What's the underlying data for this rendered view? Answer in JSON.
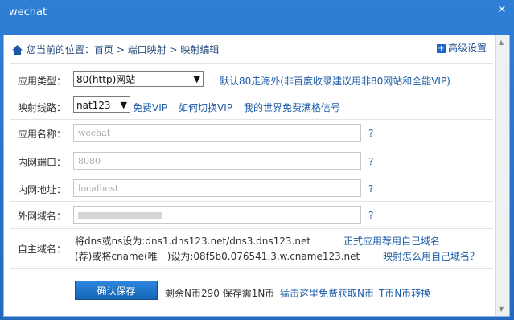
{
  "window": {
    "title": "wechat",
    "minimize": "—",
    "close": "✕"
  },
  "breadcrumb": {
    "text": "您当前的位置：首页 > 端口映射 > 映射编辑"
  },
  "advanced": {
    "label": "高级设置"
  },
  "app_type": {
    "label": "应用类型：",
    "value": "80(http)网站",
    "note": "默认80走海外(非百度收录建议用非80网站和全能VIP)"
  },
  "route": {
    "label": "映射线路：",
    "value": "nat123",
    "links": [
      "免费VIP",
      "如何切换VIP",
      "我的世界免费满格信号"
    ]
  },
  "app_name": {
    "label": "应用名称：",
    "value": "wechat",
    "help": "?"
  },
  "internal_port": {
    "label": "内网端口：",
    "value": "8080",
    "help": "?"
  },
  "internal_addr": {
    "label": "内网地址：",
    "value": "localhost",
    "help": "?"
  },
  "external_domain": {
    "label": "外网域名：",
    "help": "?"
  },
  "own_domain": {
    "label": "自主域名：",
    "line1": "将dns或ns设为:dns1.dns123.net/dns3.dns123.net",
    "link1": "正式应用荐用自己域名",
    "line2": "(荐)或将cname(唯一)设为:08f5b0.076541.3.w.cname123.net",
    "link2": "映射怎么用自己域名？"
  },
  "footer": {
    "save_label": "确认保存",
    "balance_text": "剩余N币290  保存需1N币",
    "link1": "猛击这里免费获取N币",
    "link2": "T币N币转换"
  }
}
